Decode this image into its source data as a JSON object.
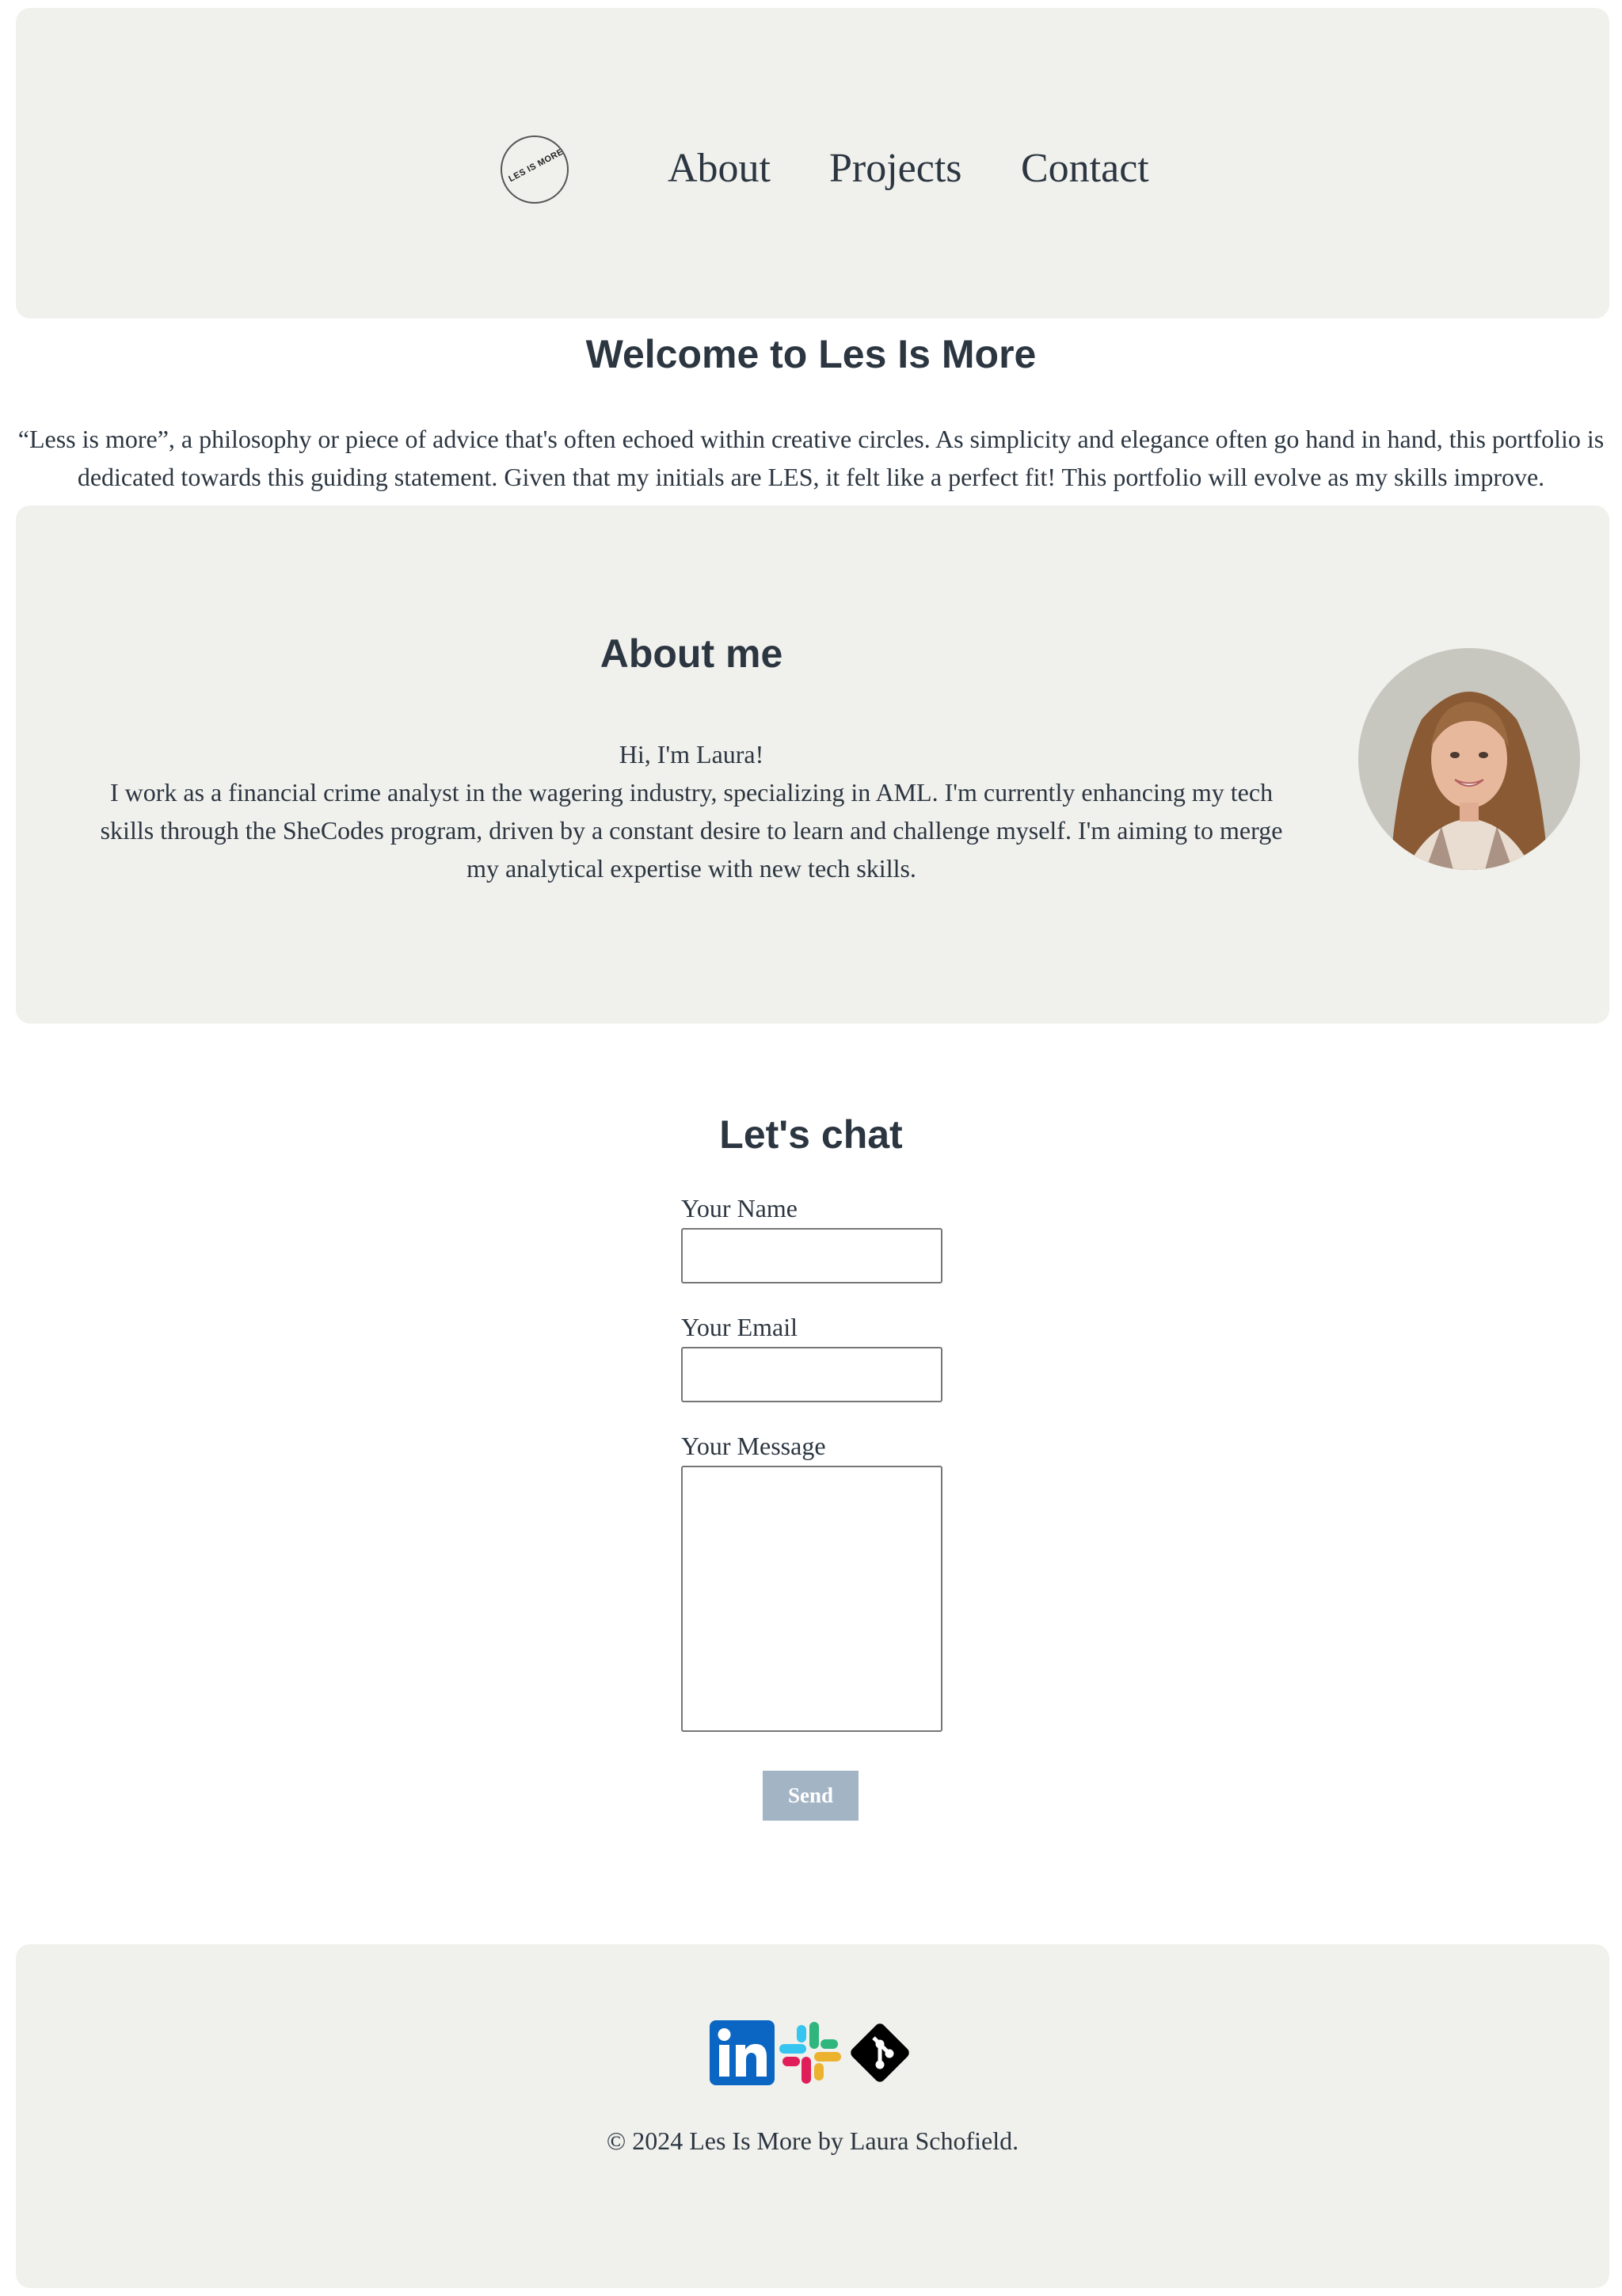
{
  "header": {
    "logo_text": "LES IS MORE",
    "nav": [
      {
        "label": "About"
      },
      {
        "label": "Projects"
      },
      {
        "label": "Contact"
      }
    ]
  },
  "welcome": {
    "title": "Welcome to Les Is More",
    "intro": "“Less is more”, a philosophy or piece of advice that's often echoed within creative circles. As simplicity and elegance often go hand in hand, this portfolio is dedicated towards this guiding statement. Given that my initials are LES, it felt like a perfect fit! This portfolio will evolve as my skills improve."
  },
  "about": {
    "title": "About me",
    "greeting": "Hi, I'm Laura!",
    "body": "I work as a financial crime analyst in the wagering industry, specializing in AML. I'm currently enhancing my tech skills through the SheCodes program, driven by a constant desire to learn and challenge myself. I'm aiming to merge my analytical expertise with new tech skills."
  },
  "chat": {
    "title": "Let's chat",
    "name_label": "Your Name",
    "name_value": "",
    "email_label": "Your Email",
    "email_value": "",
    "message_label": "Your Message",
    "message_value": "",
    "send_label": "Send"
  },
  "footer": {
    "socials": [
      {
        "icon": "linkedin-icon",
        "color": "#0a66c2"
      },
      {
        "icon": "slack-icon",
        "colors": [
          "#36c5f0",
          "#2eb67d",
          "#ecb22e",
          "#e01e5a"
        ]
      },
      {
        "icon": "git-icon",
        "color": "#000000"
      }
    ],
    "copyright": "© 2024 Les Is More by Laura Schofield."
  },
  "colors": {
    "panel_bg": "#f0f0ec",
    "text": "#2c3641",
    "button_bg": "#a3b4c5"
  }
}
